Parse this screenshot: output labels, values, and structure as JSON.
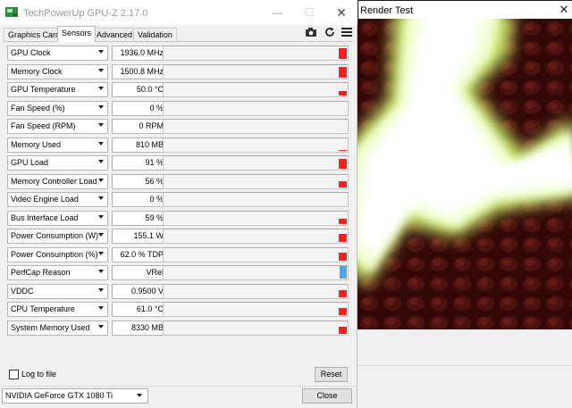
{
  "gpuz": {
    "title": "TechPowerUp GPU-Z 2.17.0",
    "window_controls": {
      "minimize": "—",
      "maximize": "☐",
      "close": "✕"
    },
    "tabs": [
      {
        "label": "Graphics Card",
        "active": false
      },
      {
        "label": "Sensors",
        "active": true
      },
      {
        "label": "Advanced",
        "active": false
      },
      {
        "label": "Validation",
        "active": false
      }
    ],
    "toolbar_icons": [
      "camera-icon",
      "refresh-icon",
      "menu-icon"
    ],
    "sensors": [
      {
        "label": "GPU Clock",
        "value": "1936.0 MHz",
        "graph_level": 0.82,
        "color": "red"
      },
      {
        "label": "Memory Clock",
        "value": "1500.8 MHz",
        "graph_level": 0.82,
        "color": "red"
      },
      {
        "label": "GPU Temperature",
        "value": "50.0 °C",
        "graph_level": 0.35,
        "color": "red"
      },
      {
        "label": "Fan Speed (%)",
        "value": "0 %",
        "graph_level": 0,
        "color": "red"
      },
      {
        "label": "Fan Speed (RPM)",
        "value": "0 RPM",
        "graph_level": 0,
        "color": "red"
      },
      {
        "label": "Memory Used",
        "value": "810 MB",
        "graph_level": 0.08,
        "color": "red"
      },
      {
        "label": "GPU Load",
        "value": "91 %",
        "graph_level": 0.7,
        "color": "red"
      },
      {
        "label": "Memory Controller Load",
        "value": "56 %",
        "graph_level": 0.45,
        "color": "red"
      },
      {
        "label": "Video Engine Load",
        "value": "0 %",
        "graph_level": 0,
        "color": "red"
      },
      {
        "label": "Bus Interface Load",
        "value": "59 %",
        "graph_level": 0.42,
        "color": "red"
      },
      {
        "label": "Power Consumption (W)",
        "value": "155.1 W",
        "graph_level": 0.6,
        "color": "red"
      },
      {
        "label": "Power Consumption (%)",
        "value": "62.0 % TDP",
        "graph_level": 0.6,
        "color": "red"
      },
      {
        "label": "PerfCap Reason",
        "value": "VRel",
        "graph_level": 1.0,
        "color": "blue"
      },
      {
        "label": "VDDC",
        "value": "0.9500 V",
        "graph_level": 0.5,
        "color": "red"
      },
      {
        "label": "CPU Temperature",
        "value": "61.0 °C",
        "graph_level": 0.5,
        "color": "red"
      },
      {
        "label": "System Memory Used",
        "value": "8330 MB",
        "graph_level": 0.55,
        "color": "red"
      }
    ],
    "log_to_file_label": "Log to file",
    "log_to_file_checked": false,
    "reset_label": "Reset",
    "gpu_select_value": "NVIDIA GeForce GTX 1080 Ti",
    "close_label": "Close",
    "colors": {
      "graph_red": "#ff1e1e",
      "graph_blue": "#5aa0e6"
    }
  },
  "render_test": {
    "title": "Render Test",
    "close": "✕"
  }
}
